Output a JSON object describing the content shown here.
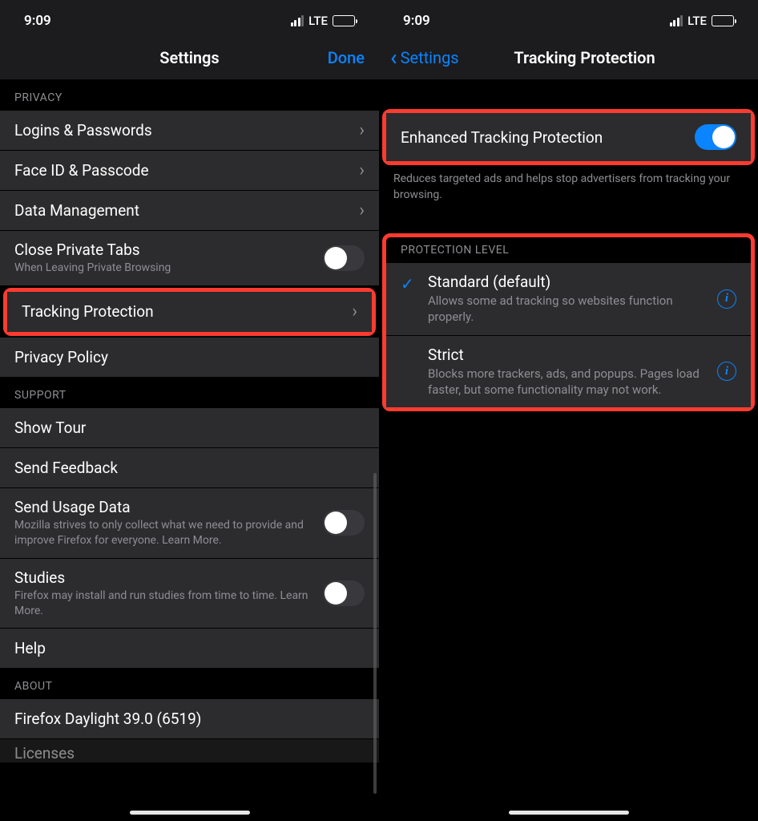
{
  "left": {
    "status": {
      "time": "9:09",
      "network": "LTE"
    },
    "nav": {
      "title": "Settings",
      "done": "Done"
    },
    "sections": {
      "privacy": {
        "header": "PRIVACY",
        "items": {
          "logins": {
            "title": "Logins & Passwords"
          },
          "faceid": {
            "title": "Face ID & Passcode"
          },
          "datamgmt": {
            "title": "Data Management"
          },
          "closetabs": {
            "title": "Close Private Tabs",
            "subtitle": "When Leaving Private Browsing"
          },
          "tracking": {
            "title": "Tracking Protection"
          },
          "privacypolicy": {
            "title": "Privacy Policy"
          }
        }
      },
      "support": {
        "header": "SUPPORT",
        "items": {
          "showtour": {
            "title": "Show Tour"
          },
          "feedback": {
            "title": "Send Feedback"
          },
          "usage": {
            "title": "Send Usage Data",
            "subtitle": "Mozilla strives to only collect what we need to provide and improve Firefox for everyone. Learn More."
          },
          "studies": {
            "title": "Studies",
            "subtitle": "Firefox may install and run studies from time to time. Learn More."
          },
          "help": {
            "title": "Help"
          }
        }
      },
      "about": {
        "header": "ABOUT",
        "items": {
          "version": {
            "title": "Firefox Daylight 39.0 (6519)"
          },
          "licenses": {
            "title": "Licenses"
          }
        }
      }
    }
  },
  "right": {
    "status": {
      "time": "9:09",
      "network": "LTE"
    },
    "nav": {
      "back": "Settings",
      "title": "Tracking Protection"
    },
    "etp": {
      "title": "Enhanced Tracking Protection",
      "footer": "Reduces targeted ads and helps stop advertisers from tracking your browsing."
    },
    "level": {
      "header": "PROTECTION LEVEL",
      "standard": {
        "title": "Standard (default)",
        "sub": "Allows some ad tracking so websites function properly."
      },
      "strict": {
        "title": "Strict",
        "sub": "Blocks more trackers, ads, and popups. Pages load faster, but some functionality may not work."
      }
    }
  }
}
